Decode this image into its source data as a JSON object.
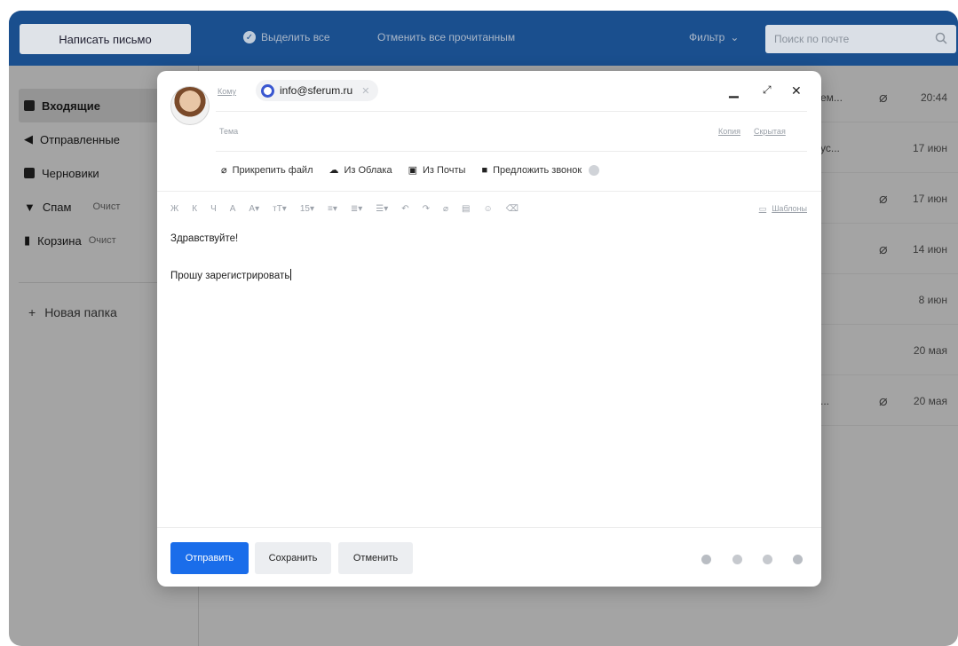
{
  "toolbar": {
    "compose_label": "Написать письмо",
    "select_all_label": "Выделить все",
    "mark_read_label": "Отменить все прочитанным",
    "filter_label": "Фильтр",
    "search_placeholder": "Поиск по почте"
  },
  "sidebar": {
    "items": [
      {
        "label": "Входящие"
      },
      {
        "label": "Отправленные"
      },
      {
        "label": "Черновики"
      },
      {
        "label": "Спам",
        "action": "Очист"
      },
      {
        "label": "Корзина",
        "action": "Очист"
      }
    ],
    "new_folder_label": "Новая папка"
  },
  "messages": [
    {
      "snippet": "ем...",
      "attachment": true,
      "date": "20:44"
    },
    {
      "snippet": "ус...",
      "attachment": false,
      "date": "17 июн"
    },
    {
      "snippet": "",
      "attachment": true,
      "date": "17 июн"
    },
    {
      "snippet": "",
      "attachment": true,
      "date": "14 июн"
    },
    {
      "snippet": "",
      "attachment": false,
      "date": "8 июн"
    },
    {
      "snippet": "",
      "attachment": false,
      "date": "20 мая"
    },
    {
      "snippet": "...",
      "attachment": true,
      "date": "20 мая"
    }
  ],
  "compose": {
    "to_label": "Кому",
    "recipient": "info@sferum.ru",
    "subject_label": "Тема",
    "cc_label": "Копия",
    "bcc_label": "Скрытая",
    "attach_file_label": "Прикрепить файл",
    "from_cloud_label": "Из Облака",
    "from_mail_label": "Из Почты",
    "propose_call_label": "Предложить звонок",
    "font_size": "15",
    "templates_label": "Шаблоны",
    "body_line1": "Здравствуйте!",
    "body_line2": "Прошу зарегистрировать",
    "send_label": "Отправить",
    "save_label": "Сохранить",
    "cancel_label": "Отменить"
  },
  "colors": {
    "topbar": "#1a4f8e",
    "send_button": "#1a6dea",
    "recipient_icon": "#3a57d0"
  }
}
